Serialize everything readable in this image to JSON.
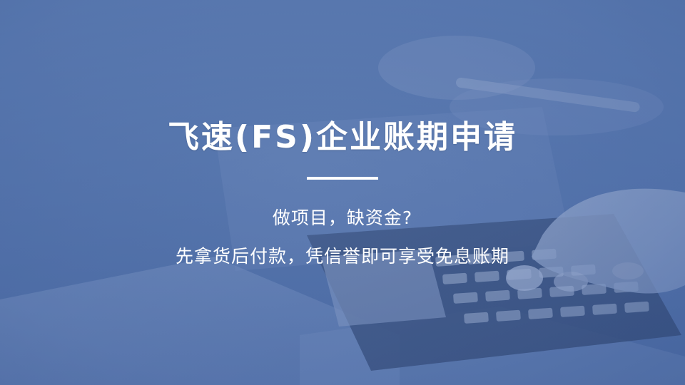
{
  "banner": {
    "title": "飞速(FS)企业账期申请",
    "subtitle_line1": "做项目，缺资金?",
    "subtitle_line2": "先拿货后付款，凭信誉即可享受免息账期"
  },
  "colors": {
    "background": "#5777ae",
    "text": "#ffffff"
  }
}
